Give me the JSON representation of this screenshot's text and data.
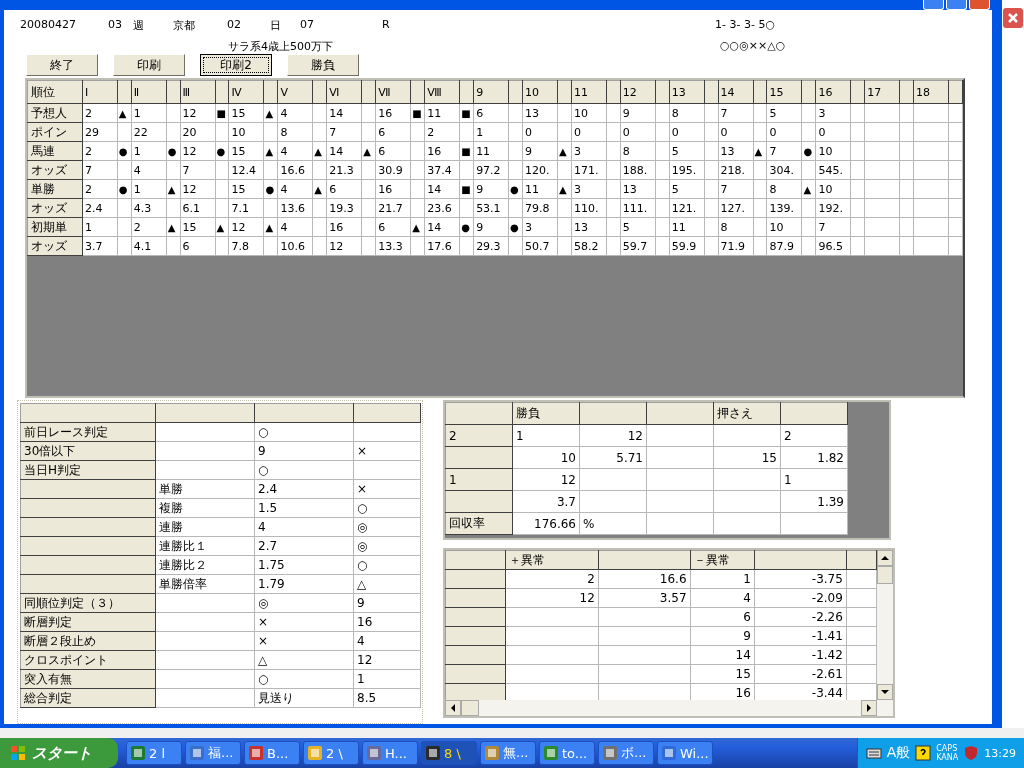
{
  "header": {
    "date": "20080427",
    "week_no": "03",
    "week_label": "週",
    "venue": "京都",
    "day_no": "02",
    "day_label": "日",
    "race_no": "07",
    "race_label": "R",
    "race_class": "サラ系4歳上500万下",
    "combo": "1- 3- 3- 5○",
    "marks": "○○◎××△○"
  },
  "buttons": [
    {
      "label": "終了",
      "focused": false
    },
    {
      "label": "印刷",
      "focused": false
    },
    {
      "label": "印刷2",
      "focused": true
    },
    {
      "label": "勝負",
      "focused": false
    }
  ],
  "ranking_grid": {
    "corner": "順位",
    "columns": [
      "Ⅰ",
      "Ⅱ",
      "Ⅲ",
      "Ⅳ",
      "Ⅴ",
      "Ⅵ",
      "Ⅶ",
      "Ⅷ",
      "9",
      "10",
      "11",
      "12",
      "13",
      "14",
      "15",
      "16",
      "17",
      "18"
    ],
    "rows": [
      {
        "label": "予想人",
        "cells": [
          [
            "2",
            "▲"
          ],
          [
            "1",
            null
          ],
          [
            "12",
            "■"
          ],
          [
            "15",
            "▲"
          ],
          [
            "4",
            null
          ],
          [
            "14",
            null
          ],
          [
            "16",
            "■"
          ],
          [
            "11",
            "■"
          ],
          [
            "6",
            null
          ],
          [
            "13",
            null
          ],
          [
            "10",
            null
          ],
          [
            "9",
            null
          ],
          [
            "8",
            null
          ],
          [
            "7",
            null
          ],
          [
            "5",
            null
          ],
          [
            "3",
            null
          ],
          [
            null,
            null
          ],
          [
            null,
            null
          ]
        ]
      },
      {
        "label": "ポイン",
        "cells": [
          [
            "29",
            null
          ],
          [
            "22",
            null
          ],
          [
            "20",
            null
          ],
          [
            "10",
            null
          ],
          [
            "8",
            null
          ],
          [
            "7",
            null
          ],
          [
            "6",
            null
          ],
          [
            "2",
            null
          ],
          [
            "1",
            null
          ],
          [
            "0",
            null
          ],
          [
            "0",
            null
          ],
          [
            "0",
            null
          ],
          [
            "0",
            null
          ],
          [
            "0",
            null
          ],
          [
            "0",
            null
          ],
          [
            "0",
            null
          ],
          [
            null,
            null
          ],
          [
            null,
            null
          ]
        ]
      },
      {
        "label": "馬連",
        "cells": [
          [
            "2",
            "●"
          ],
          [
            "1",
            "●"
          ],
          [
            "12",
            "●"
          ],
          [
            "15",
            "▲"
          ],
          [
            "4",
            "▲"
          ],
          [
            "14",
            "▲"
          ],
          [
            "6",
            null
          ],
          [
            "16",
            "■"
          ],
          [
            "11",
            null
          ],
          [
            "9",
            "▲"
          ],
          [
            "3",
            null
          ],
          [
            "8",
            null
          ],
          [
            "5",
            null
          ],
          [
            "13",
            "▲"
          ],
          [
            "7",
            "●"
          ],
          [
            "10",
            null
          ],
          [
            null,
            null
          ],
          [
            null,
            null
          ]
        ]
      },
      {
        "label": "オッズ",
        "cells": [
          [
            "7",
            null
          ],
          [
            "4",
            null
          ],
          [
            "7",
            null
          ],
          [
            "12.4",
            null
          ],
          [
            "16.6",
            null
          ],
          [
            "21.3",
            null
          ],
          [
            "30.9",
            null
          ],
          [
            "37.4",
            null
          ],
          [
            "97.2",
            null
          ],
          [
            "120.",
            null
          ],
          [
            "171.",
            null
          ],
          [
            "188.",
            null
          ],
          [
            "195.",
            null
          ],
          [
            "218.",
            null
          ],
          [
            "304.",
            null
          ],
          [
            "545.",
            null
          ],
          [
            null,
            null
          ],
          [
            null,
            null
          ]
        ]
      },
      {
        "label": "単勝",
        "cells": [
          [
            "2",
            "●"
          ],
          [
            "1",
            "▲"
          ],
          [
            "12",
            null
          ],
          [
            "15",
            "●"
          ],
          [
            "4",
            "▲"
          ],
          [
            "6",
            null
          ],
          [
            "16",
            null
          ],
          [
            "14",
            "■"
          ],
          [
            "9",
            "●"
          ],
          [
            "11",
            "▲"
          ],
          [
            "3",
            null
          ],
          [
            "13",
            null
          ],
          [
            "5",
            null
          ],
          [
            "7",
            null
          ],
          [
            "8",
            "▲"
          ],
          [
            "10",
            null
          ],
          [
            null,
            null
          ],
          [
            null,
            null
          ]
        ]
      },
      {
        "label": "オッズ",
        "cells": [
          [
            "2.4",
            null
          ],
          [
            "4.3",
            null
          ],
          [
            "6.1",
            null
          ],
          [
            "7.1",
            null
          ],
          [
            "13.6",
            null
          ],
          [
            "19.3",
            null
          ],
          [
            "21.7",
            null
          ],
          [
            "23.6",
            null
          ],
          [
            "53.1",
            null
          ],
          [
            "79.8",
            null
          ],
          [
            "110.",
            null
          ],
          [
            "111.",
            null
          ],
          [
            "121.",
            null
          ],
          [
            "127.",
            null
          ],
          [
            "139.",
            null
          ],
          [
            "192.",
            null
          ],
          [
            null,
            null
          ],
          [
            null,
            null
          ]
        ]
      },
      {
        "label": "初期単",
        "cells": [
          [
            "1",
            null
          ],
          [
            "2",
            "▲"
          ],
          [
            "15",
            "▲"
          ],
          [
            "12",
            "▲"
          ],
          [
            "4",
            null
          ],
          [
            "16",
            null
          ],
          [
            "6",
            "▲"
          ],
          [
            "14",
            "●"
          ],
          [
            "9",
            "●"
          ],
          [
            "3",
            null
          ],
          [
            "13",
            null
          ],
          [
            "5",
            null
          ],
          [
            "11",
            null
          ],
          [
            "8",
            null
          ],
          [
            "10",
            null
          ],
          [
            "7",
            null
          ],
          [
            null,
            null
          ],
          [
            null,
            null
          ]
        ]
      },
      {
        "label": "オッズ",
        "cells": [
          [
            "3.7",
            null
          ],
          [
            "4.1",
            null
          ],
          [
            "6",
            null
          ],
          [
            "7.8",
            null
          ],
          [
            "10.6",
            null
          ],
          [
            "12",
            null
          ],
          [
            "13.3",
            null
          ],
          [
            "17.6",
            null
          ],
          [
            "29.3",
            null
          ],
          [
            "50.7",
            null
          ],
          [
            "58.2",
            null
          ],
          [
            "59.7",
            null
          ],
          [
            "59.9",
            null
          ],
          [
            "71.9",
            null
          ],
          [
            "87.9",
            null
          ],
          [
            "96.5",
            null
          ],
          [
            null,
            null
          ],
          [
            null,
            null
          ]
        ]
      }
    ]
  },
  "judgement_table": {
    "rows": [
      [
        "前日レース判定",
        null,
        "○",
        null
      ],
      [
        "30倍以下",
        null,
        "9",
        "×"
      ],
      [
        "当日H判定",
        null,
        "○",
        null
      ],
      [
        null,
        "単勝",
        "2.4",
        "×"
      ],
      [
        null,
        "複勝",
        "1.5",
        "○"
      ],
      [
        null,
        "連勝",
        "4",
        "◎"
      ],
      [
        null,
        "連勝比１",
        "2.7",
        "◎"
      ],
      [
        null,
        "連勝比２",
        "1.75",
        "○"
      ],
      [
        null,
        "単勝倍率",
        "1.79",
        "△"
      ],
      [
        "同順位判定（３）",
        null,
        "◎",
        "9"
      ],
      [
        "断層判定",
        null,
        "×",
        "16"
      ],
      [
        "断層２段止め",
        null,
        "×",
        "4"
      ],
      [
        "クロスポイント",
        null,
        "△",
        "12"
      ],
      [
        "突入有無",
        null,
        "○",
        "1"
      ],
      [
        "総合判定",
        null,
        "見送り",
        "8.5"
      ]
    ]
  },
  "bet_table": {
    "columns": [
      null,
      "勝負",
      null,
      null,
      "押さえ",
      null
    ],
    "rows": [
      [
        "2",
        "1",
        "12",
        null,
        null,
        "2"
      ],
      [
        null,
        "10",
        "5.71",
        null,
        "15",
        "1.82"
      ],
      [
        "1",
        "12",
        null,
        null,
        null,
        "1"
      ],
      [
        null,
        "3.7",
        null,
        null,
        null,
        "1.39"
      ],
      [
        "回収率",
        "176.66",
        "%",
        null,
        null,
        null
      ]
    ]
  },
  "anomaly_table": {
    "columns": [
      null,
      "＋異常",
      null,
      "－異常",
      null,
      null
    ],
    "rows": [
      [
        null,
        "2",
        "16.6",
        "1",
        "-3.75",
        null
      ],
      [
        null,
        "12",
        "3.57",
        "4",
        "-2.09",
        null
      ],
      [
        null,
        null,
        null,
        "6",
        "-2.26",
        null
      ],
      [
        null,
        null,
        null,
        "9",
        "-1.41",
        null
      ],
      [
        null,
        null,
        null,
        "14",
        "-1.42",
        null
      ],
      [
        null,
        null,
        null,
        "15",
        "-2.61",
        null
      ],
      [
        null,
        null,
        null,
        "16",
        "-3.44",
        null
      ]
    ]
  },
  "taskbar": {
    "start": "スタート",
    "tasks": [
      {
        "label": "2 l",
        "selected": false
      },
      {
        "label": "福...",
        "selected": false
      },
      {
        "label": "B...",
        "selected": false
      },
      {
        "label": "2 \\",
        "selected": false
      },
      {
        "label": "H...",
        "selected": false
      },
      {
        "label": "8 \\",
        "selected": true
      },
      {
        "label": "無...",
        "selected": false
      },
      {
        "label": "to...",
        "selected": false
      },
      {
        "label": "ボ...",
        "selected": false
      },
      {
        "label": "Wi...",
        "selected": false
      }
    ],
    "ime": "A般",
    "caps": "CAPS",
    "kana": "KANA",
    "clock": "13:29"
  }
}
